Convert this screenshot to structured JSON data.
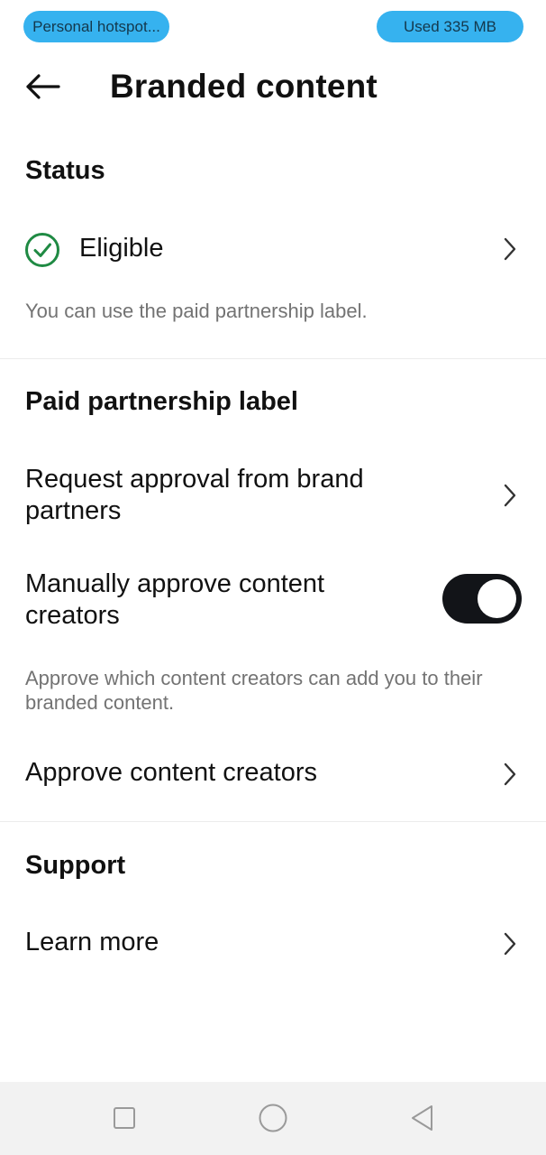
{
  "status_bar": {
    "hotspot_label": "Personal hotspot...",
    "data_usage": "Used  335 MB"
  },
  "header": {
    "title": "Branded content",
    "back_icon": "arrow-left-icon"
  },
  "status_section": {
    "title": "Status",
    "status_label": "Eligible",
    "status_icon": "check-circle-icon",
    "status_color": "#1f8a43",
    "description": "You can use the paid partnership label."
  },
  "paid_partnership_section": {
    "title": "Paid partnership label",
    "request_approval_label": "Request approval from brand partners",
    "manual_approve_label": "Manually approve content creators",
    "manual_approve_enabled": true,
    "manual_approve_description": "Approve which content creators can add you to their branded content.",
    "approve_creators_label": "Approve content creators"
  },
  "support_section": {
    "title": "Support",
    "learn_more_label": "Learn more"
  },
  "nav_bar": {
    "recent_icon": "square-icon",
    "home_icon": "circle-icon",
    "back_icon": "triangle-back-icon"
  }
}
